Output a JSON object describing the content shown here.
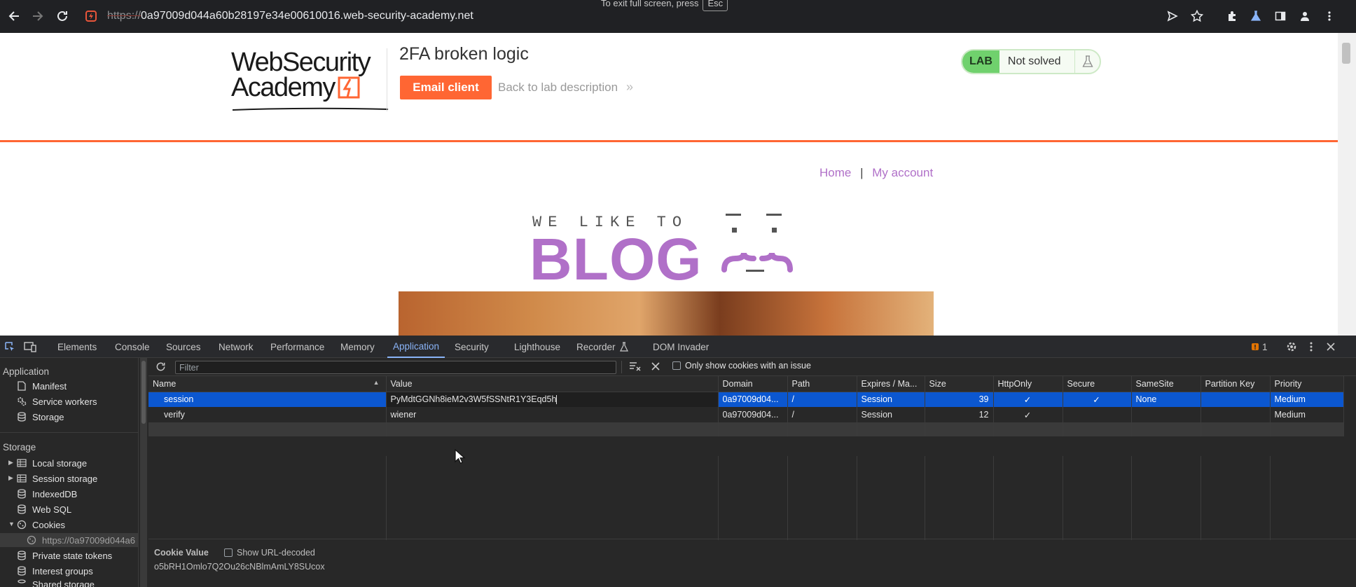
{
  "browser": {
    "url_proto": "https://",
    "url_host": "0a97009d044a60b28197e34e00610016.web-security-academy.net",
    "fullscreen_hint": "To exit full screen, press",
    "fullscreen_key": "Esc"
  },
  "page": {
    "logo_line1": "WebSecurity",
    "logo_line2": "Academy",
    "lab_title": "2FA broken logic",
    "email_client_label": "Email client",
    "back_link_label": "Back to lab description",
    "back_chevron": "»",
    "lab_badge": "LAB",
    "lab_status": "Not solved",
    "nav_home": "Home",
    "nav_sep": "|",
    "nav_account": "My account",
    "blog_tagline": "WE LIKE TO",
    "blog_word": "BLOG"
  },
  "devtools": {
    "tabs": [
      "Elements",
      "Console",
      "Sources",
      "Network",
      "Performance",
      "Memory",
      "Application",
      "Security",
      "Lighthouse",
      "Recorder",
      "DOM Invader"
    ],
    "active_tab": "Application",
    "issue_count": "1",
    "sidebar": {
      "application_header": "Application",
      "manifest": "Manifest",
      "service_workers": "Service workers",
      "storage": "Storage",
      "storage_header": "Storage",
      "local_storage": "Local storage",
      "session_storage": "Session storage",
      "indexeddb": "IndexedDB",
      "web_sql": "Web SQL",
      "cookies": "Cookies",
      "cookie_origin": "https://0a97009d044a6",
      "private_state_tokens": "Private state tokens",
      "interest_groups": "Interest groups",
      "shared_storage": "Shared storage"
    },
    "toolbar": {
      "filter_placeholder": "Filter",
      "only_issue_label": "Only show cookies with an issue"
    },
    "columns": [
      "Name",
      "Value",
      "Domain",
      "Path",
      "Expires / Ma...",
      "Size",
      "HttpOnly",
      "Secure",
      "SameSite",
      "Partition Key",
      "Priority"
    ],
    "rows": [
      {
        "name": "session",
        "value": "PyMdtGGNh8ieM2v3W5fSSNtR1Y3Eqd5h",
        "domain": "0a97009d04...",
        "path": "/",
        "expires": "Session",
        "size": "39",
        "httponly": "✓",
        "secure": "✓",
        "samesite": "None",
        "partition": "",
        "priority": "Medium"
      },
      {
        "name": "verify",
        "value": "wiener",
        "domain": "0a97009d04...",
        "path": "/",
        "expires": "Session",
        "size": "12",
        "httponly": "✓",
        "secure": "",
        "samesite": "",
        "partition": "",
        "priority": "Medium"
      }
    ],
    "cookie_value_title": "Cookie Value",
    "show_url_decoded": "Show URL-decoded",
    "cookie_value": "o5bRH1Omlo7Q2Ou26cNBlmAmLY8SUcox"
  },
  "colors": {
    "accent_orange": "#ff6633",
    "blog_purple": "#b070c8",
    "devtools_active": "#8ab4f8",
    "selection_blue": "#0b57d0"
  }
}
